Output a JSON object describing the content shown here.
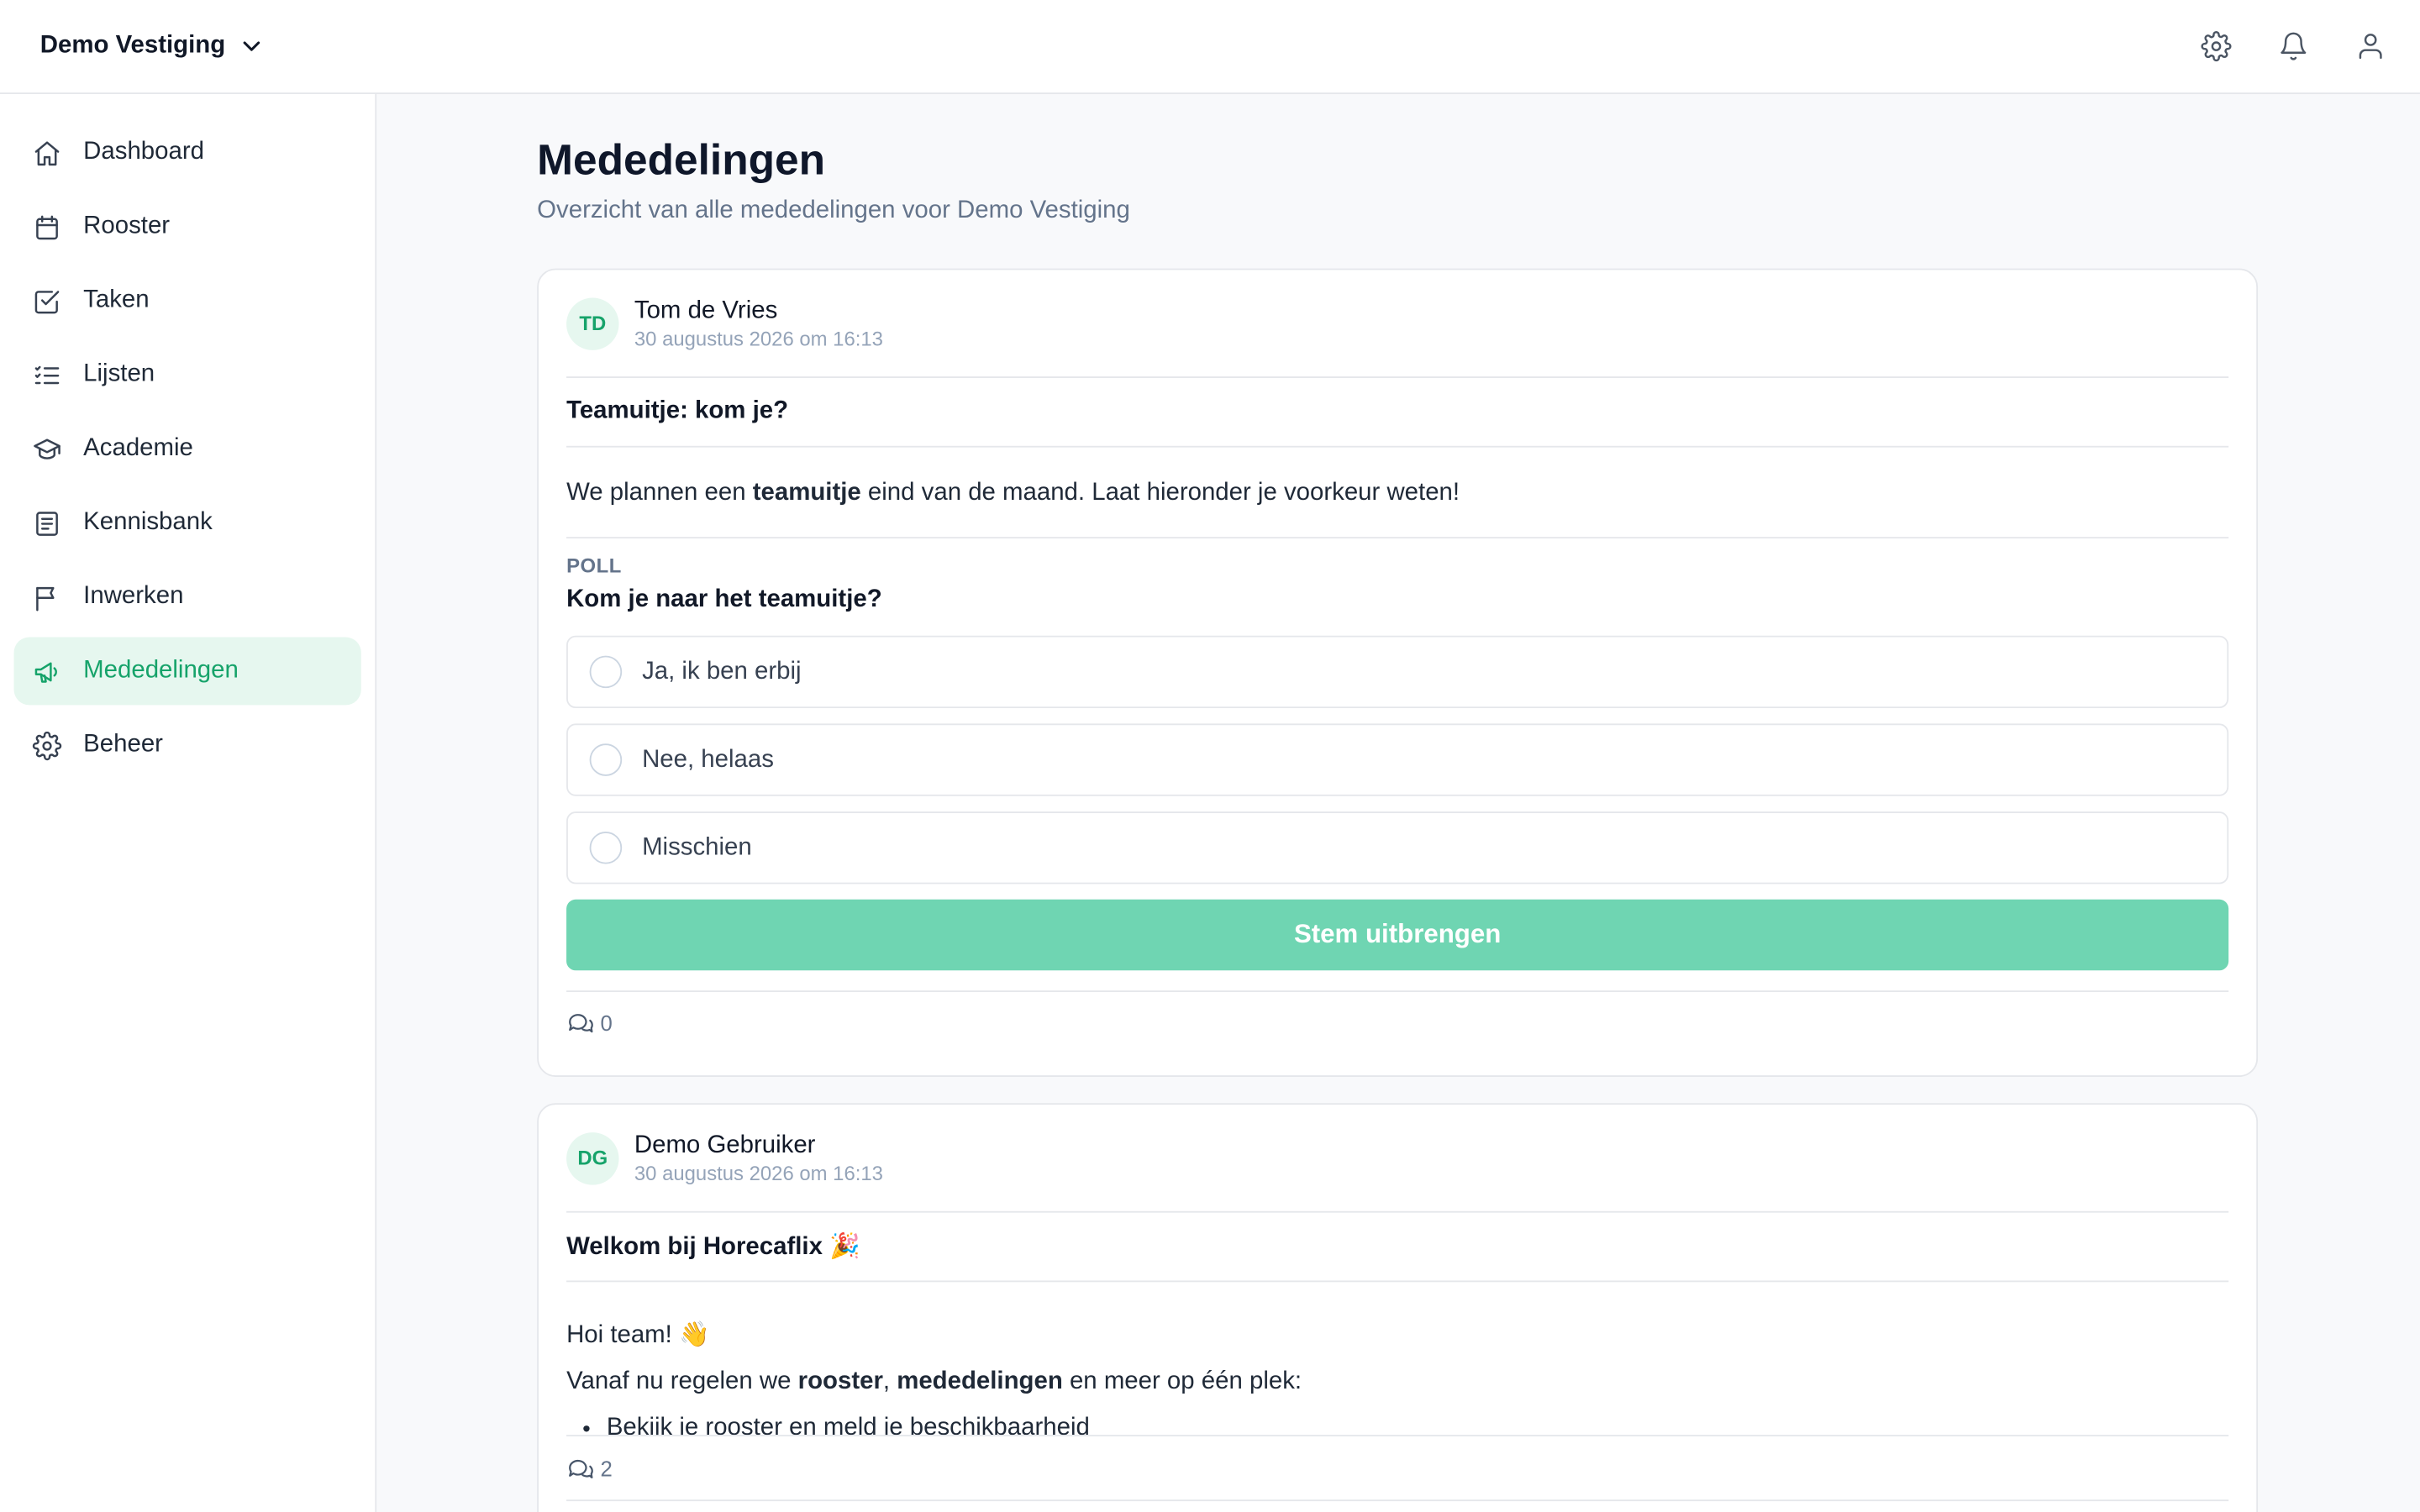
{
  "header": {
    "org_name": "Demo Vestiging",
    "icons": [
      "settings-icon",
      "bell-icon",
      "user-icon"
    ]
  },
  "sidebar": {
    "items": [
      {
        "label": "Dashboard",
        "icon": "home-icon"
      },
      {
        "label": "Rooster",
        "icon": "calendar-icon"
      },
      {
        "label": "Taken",
        "icon": "checkbox-icon"
      },
      {
        "label": "Lijsten",
        "icon": "list-icon"
      },
      {
        "label": "Academie",
        "icon": "graduation-cap-icon"
      },
      {
        "label": "Kennisbank",
        "icon": "document-icon"
      },
      {
        "label": "Inwerken",
        "icon": "flag-icon"
      },
      {
        "label": "Mededelingen",
        "icon": "megaphone-icon",
        "active": true
      },
      {
        "label": "Beheer",
        "icon": "gear-icon"
      }
    ]
  },
  "page": {
    "title": "Mededelingen",
    "subtitle": "Overzicht van alle mededelingen voor Demo Vestiging"
  },
  "posts": [
    {
      "initials": "TD",
      "author": "Tom de Vries",
      "date": "30 augustus 2026 om 16:13",
      "title": "Teamuitje: kom je?",
      "body_before": "We plannen een ",
      "body_bold": "teamuitje",
      "body_after": " eind van de maand. Laat hieronder je voorkeur weten!",
      "poll": {
        "label": "POLL",
        "question": "Kom je naar het teamuitje?",
        "options": [
          "Ja, ik ben erbij",
          "Nee, helaas",
          "Misschien"
        ],
        "vote_label": "Stem uitbrengen"
      },
      "comment_count": "0"
    },
    {
      "initials": "DG",
      "author": "Demo Gebruiker",
      "date": "30 augustus 2026 om 16:13",
      "title": "Welkom bij Horecaflix 🎉",
      "line1": "Hoi team! 👋",
      "line2_a": "Vanaf nu regelen we ",
      "line2_b": "rooster",
      "line2_c": ", ",
      "line2_d": "mededelingen",
      "line2_e": " en meer op één plek:",
      "bullet1": "Bekijk je rooster en meld je beschikbaarheid",
      "comment_count": "2"
    }
  ],
  "colors": {
    "accent": "#16a36a",
    "accent_bg": "#e6f7ef",
    "vote_button": "#6fd5b2"
  }
}
